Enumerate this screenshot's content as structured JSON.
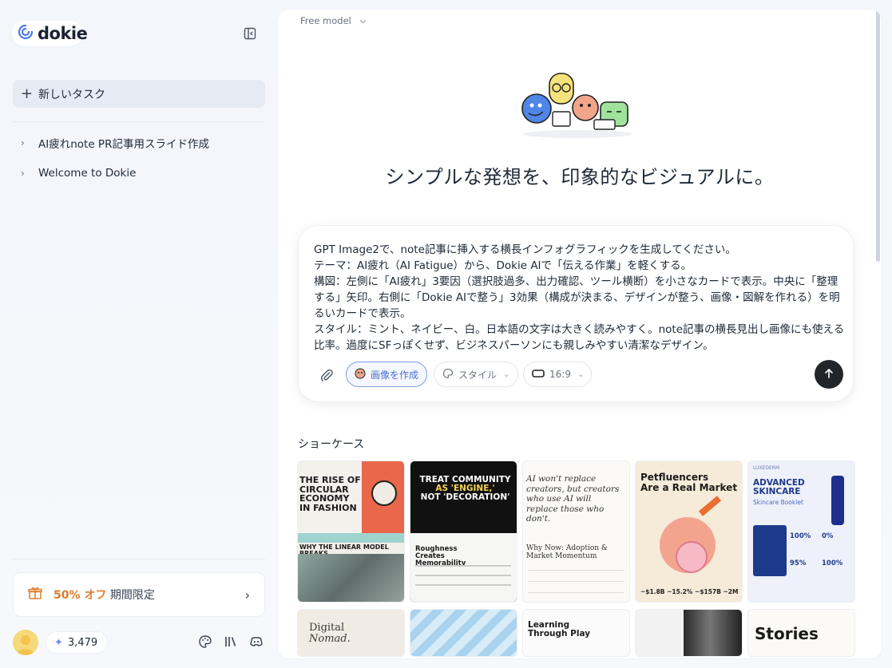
{
  "sidebar": {
    "logo": "dokie",
    "new_task_label": "新しいタスク",
    "history": [
      {
        "label": "AI疲れnote PR記事用スライド作成"
      },
      {
        "label": "Welcome to Dokie"
      }
    ],
    "promo": {
      "percent": "50% オフ",
      "limited": "期間限定"
    },
    "credits": "3,479"
  },
  "main": {
    "model_label": "Free model",
    "headline": "シンプルな発想を、印象的なビジュアルに。",
    "prompt": "GPT Image2で、note記事に挿入する横長インフォグラフィックを生成してください。\nテーマ：AI疲れ（AI Fatigue）から、Dokie AIで「伝える作業」を軽くする。\n構図：左側に「AI疲れ」3要因（選択肢過多、出力確認、ツール横断）を小さなカードで表示。中央に「整理する」矢印。右側に「Dokie AIで整う」3効果（構成が決まる、デザインが整う、画像・図解を作れる）を明るいカードで表示。\nスタイル：ミント、ネイビー、白。日本語の文字は大きく読みやすく。note記事の横長見出し画像にも使える比率。過度にSFっぽくせず、ビジネスパーソンにも親しみやすい清潔なデザイン。",
    "toolbar": {
      "create_image": "画像を作成",
      "style": "スタイル",
      "ratio": "16:9"
    },
    "showcase_title": "ショーケース",
    "showcase": [
      {
        "lines": [
          "THE RISE OF",
          "CIRCULAR ECONOMY",
          "IN FASHION"
        ],
        "sub": "WHY THE LINEAR MODEL BREAKS"
      },
      {
        "lines": [
          "TREAT COMMUNITY",
          "AS 'ENGINE,'",
          "NOT 'DECORATION'"
        ],
        "sub": "Roughness Creates Memorability"
      },
      {
        "lines": [
          "AI won't replace",
          "creators, but creators",
          "who use AI will",
          "replace those who don't."
        ],
        "sub": "Why Now: Adoption & Market Momentum"
      },
      {
        "lines": [
          "Petfluencers",
          "Are a Real Market"
        ],
        "sub": "~$1.8B  ~15.2%  ~$157B  ~2M"
      },
      {
        "lines": [
          "ADVANCED",
          "SKINCARE"
        ],
        "sub": "Skincare Booklet",
        "brand": "LUXEDERM",
        "stats": [
          "100%",
          "0%",
          "95%",
          "100%"
        ]
      },
      {
        "lines": [
          "Digital",
          "Nomad."
        ]
      },
      {
        "lines": []
      },
      {
        "lines": [
          "Learning",
          "Through Play"
        ]
      },
      {
        "lines": []
      },
      {
        "lines": [
          "Stories"
        ]
      }
    ]
  }
}
